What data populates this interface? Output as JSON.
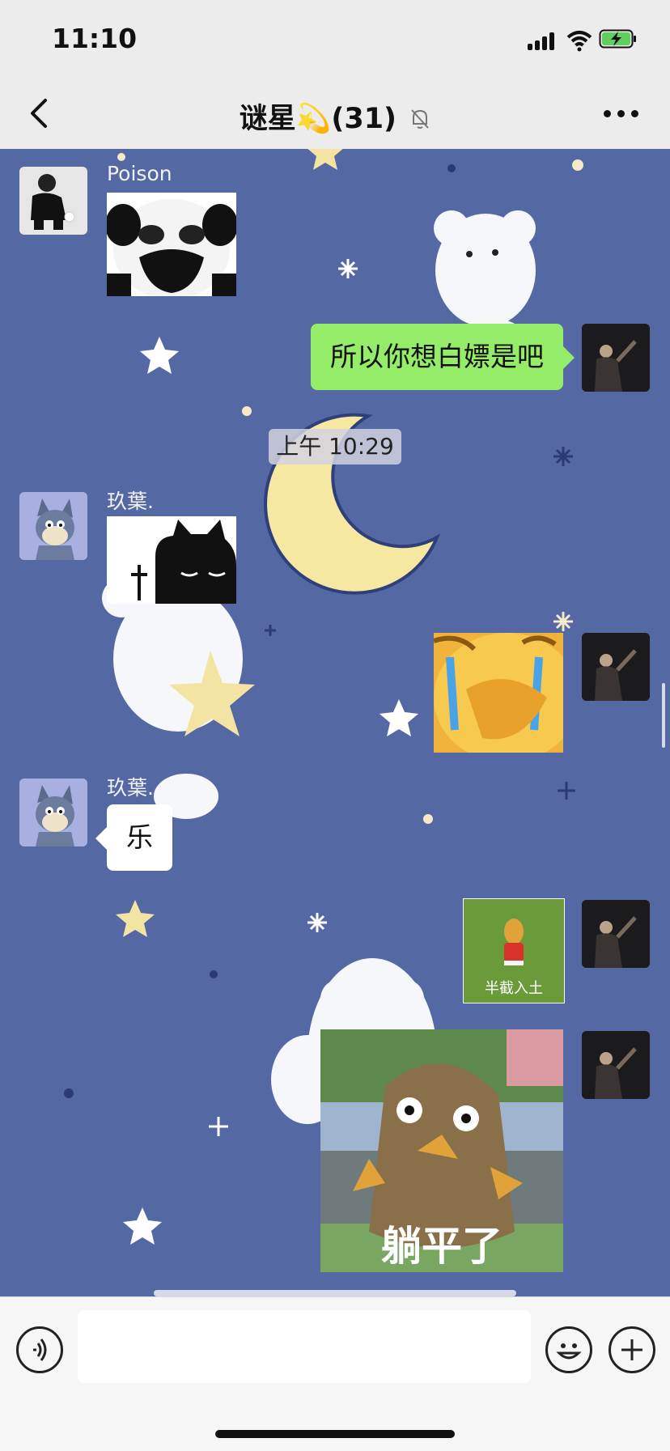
{
  "status_bar": {
    "time": "11:10"
  },
  "nav": {
    "title": "谜星💫(31)",
    "muted_icon": "bell-muted-icon"
  },
  "messages": [
    {
      "side": "left",
      "sender": "Poison",
      "type": "sticker",
      "sticker": "panda-face-meme"
    },
    {
      "side": "right",
      "type": "text",
      "text": "所以你想白嫖是吧"
    },
    {
      "type": "timestamp",
      "text": "上午 10:29"
    },
    {
      "side": "left",
      "sender": "玖葉.",
      "type": "sticker",
      "sticker": "black-cat-cross"
    },
    {
      "side": "right",
      "type": "sticker",
      "sticker": "crying-yellow-face"
    },
    {
      "side": "left",
      "sender": "玖葉.",
      "type": "text",
      "text": "乐"
    },
    {
      "side": "right",
      "type": "sticker",
      "sticker": "peanut-doll",
      "caption": "半截入土"
    },
    {
      "side": "right",
      "type": "sticker",
      "sticker": "brown-monster",
      "caption": "躺平了"
    }
  ],
  "colors": {
    "chat_bg": "#5468a4",
    "self_bubble": "#95ec69",
    "other_bubble": "#ffffff"
  }
}
